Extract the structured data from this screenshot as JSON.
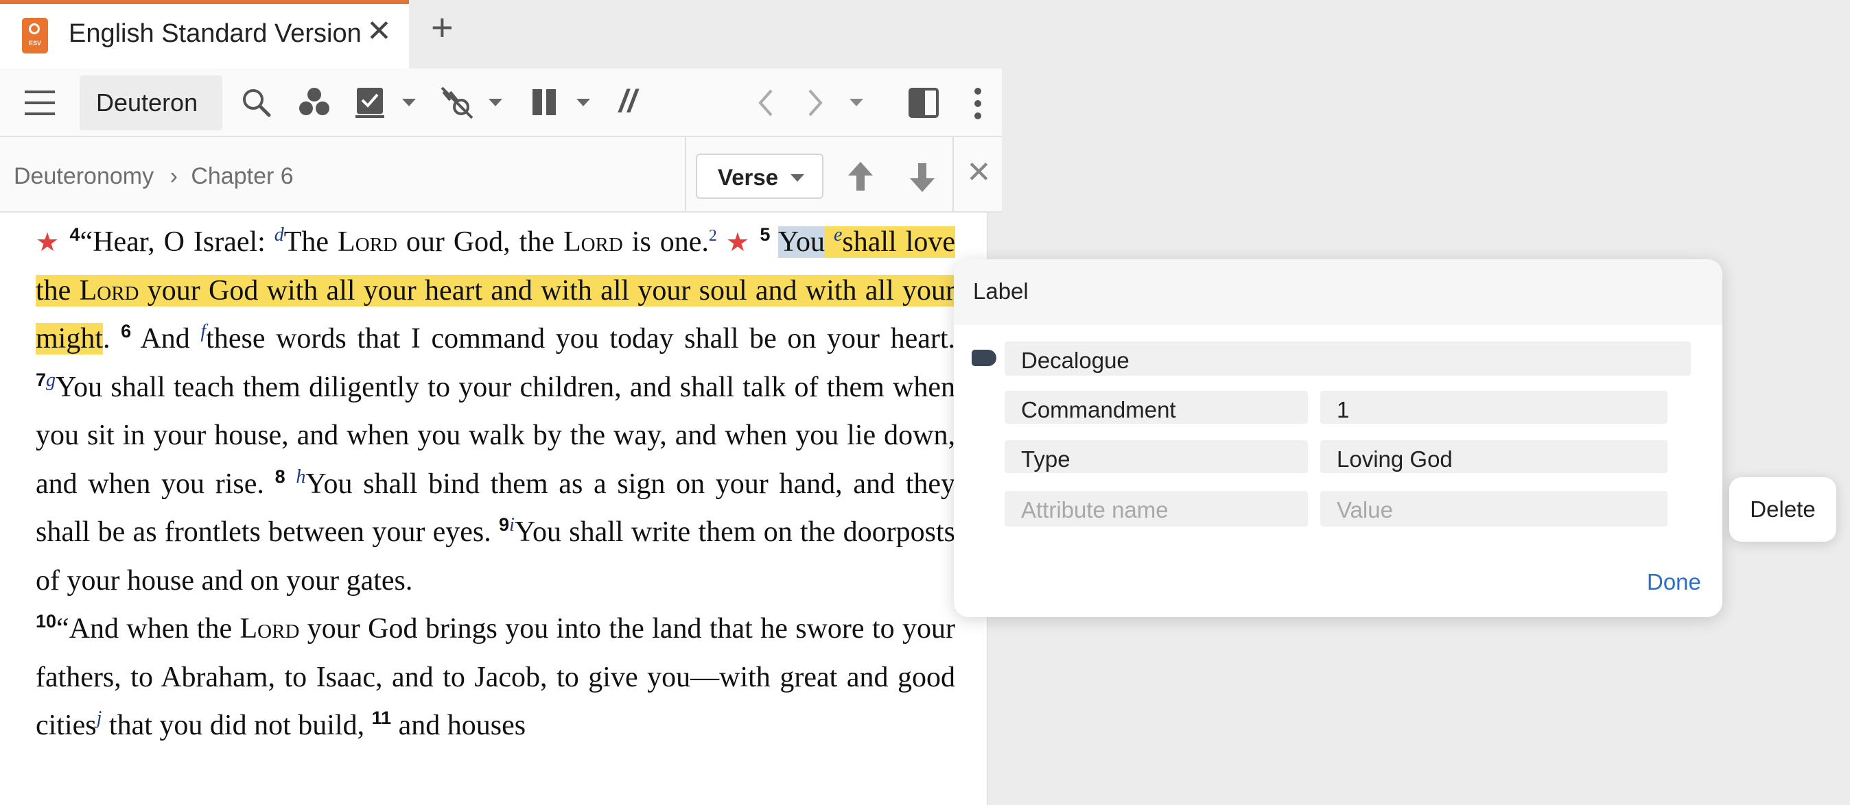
{
  "tab": {
    "icon_text": "ESV",
    "title": "English Standard Version",
    "close_glyph": "✕",
    "add_glyph": "+"
  },
  "toolbar": {
    "reference": "Deuteron",
    "parallel_glyph": "//",
    "icons": [
      "menu-icon",
      "search-icon",
      "strongs-icon",
      "checklist-icon",
      "no-compare-icon",
      "columns-icon",
      "parallel-icon",
      "back-icon",
      "forward-icon",
      "split-icon",
      "more-icon"
    ]
  },
  "breadcrumb": {
    "book": "Deuteronomy",
    "separator": "›",
    "chapter": "Chapter 6",
    "mode": "Verse",
    "close_glyph": "✕"
  },
  "bible_text": {
    "v4_num": "4",
    "v4_open": "“Hear, O Israel: ",
    "v4_fn": "d",
    "v4_a": "The ",
    "lord": "Lord",
    "v4_b": " our God, the ",
    "v4_c": " is one.",
    "v4_fnum": "2",
    "v5_num": "5",
    "v5_sel": "You",
    "v5_fn": "e",
    "v5_a": "shall love the ",
    "v5_b": " your God with all your heart and with all your soul and with all your might",
    "v5_end": ".",
    "v6_num": "6",
    "v6_a": "And ",
    "v6_fn": "f",
    "v6_b": "these words that I command you today shall be on your heart. ",
    "v7_num": "7",
    "v7_fn": "g",
    "v7_b": "You shall teach them diligently to your children, and shall talk of them when you sit in your house, and when you walk by the way, and when you lie down, and when you rise. ",
    "v8_num": "8",
    "v8_fn": "h",
    "v8_b": "You shall bind them as a sign on your hand, and they shall be as frontlets between your eyes. ",
    "v9_num": "9",
    "v9_fn": "i",
    "v9_b": "You shall write them on the doorposts of your house and on your gates.",
    "v10_num": "10",
    "v10_a": "“And when the ",
    "v10_b": " your God brings you into the land that he swore to your fathers, to Abraham, to Isaac, and to Jacob, to give you—with great and good cities",
    "v10_fn": "j",
    "v10_c": " that you did not build, ",
    "v11_num": "11",
    "v11_a": " and houses"
  },
  "popup": {
    "title": "Label",
    "label_name": "Decalogue",
    "attributes": [
      {
        "name": "Commandment",
        "value": "1"
      },
      {
        "name": "Type",
        "value": "Loving God"
      }
    ],
    "new_attribute_placeholder": "Attribute name",
    "new_value_placeholder": "Value",
    "done_label": "Done",
    "delete_label": "Delete"
  },
  "colors": {
    "accent_orange": "#e8742f",
    "highlight_yellow": "#f9dc5c",
    "link_blue": "#2b6fc7",
    "star_red": "#e04040",
    "footnote_blue": "#1b3a8a"
  }
}
